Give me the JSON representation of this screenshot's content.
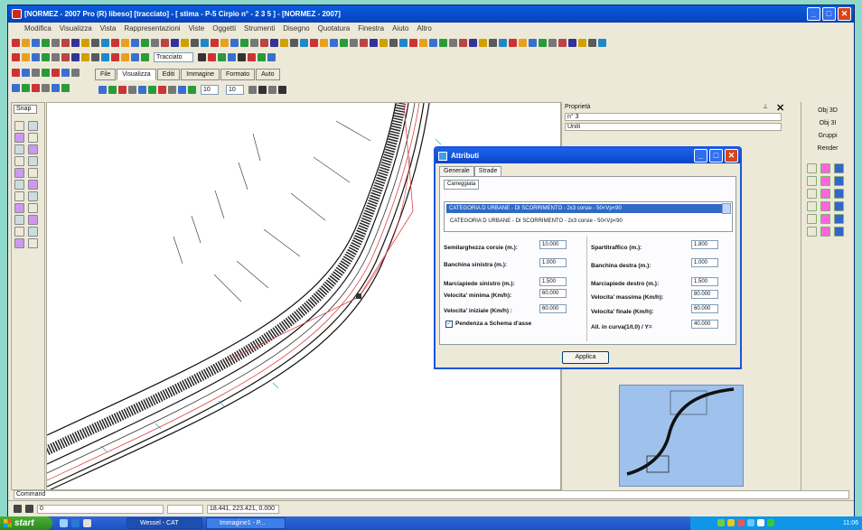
{
  "window": {
    "title": "[NORMEZ - 2007 Pro (R) libeso] [tracciato] - [ stima - P-5 Cirpio n° - 2 3 5 ] - [NORMEZ - 2007]"
  },
  "menu": [
    "Modifica",
    "Visualizza",
    "Vista",
    "Rappresentazioni",
    "Viste",
    "Oggetti",
    "Strumenti",
    "Disegno",
    "Quotatura",
    "Finestra",
    "Aiuto",
    "Altro"
  ],
  "toolbar": {
    "layer_combo": "Tracciato",
    "coord1": "10",
    "coord2": "10"
  },
  "mode_tabs": [
    "File",
    "Visualizza",
    "Editi",
    "Immagine",
    "Formato",
    "Auto"
  ],
  "left_toolbar": {
    "snap_label": "Snap"
  },
  "properties": {
    "header": "Proprietà",
    "row1": "n° 3",
    "row2": "Uniti"
  },
  "right_panel": [
    "Obj 3D",
    "Obj 3I",
    "Gruppi",
    "Render"
  ],
  "dialog": {
    "title": "Attributi",
    "tabs": [
      "Generale",
      "Strade"
    ],
    "subtab": "Carreggiata",
    "selected_item": "CATEGORIA D URBANE - DI SCORRIMENTO - 2x3 corsie - 50<Vp<90",
    "section_item": "CATEGORIA D URBANE - DI SCORRIMENTO - 2x3 corsie - 50<Vp<90",
    "fields_left": [
      {
        "label": "Semilarghezza corsie (m.):",
        "value": "10.000"
      },
      {
        "label": "Banchina sinistra (m.):",
        "value": "1.000"
      },
      {
        "label": "Marciapiede sinistro (m.):",
        "value": "1.500"
      },
      {
        "label": "Velocita' minima (Km/h):",
        "value": "60.000"
      },
      {
        "label": "Velocita' iniziale (Km/h) :",
        "value": "60.000"
      }
    ],
    "fields_right": [
      {
        "label": "Spartitraffico (m.):",
        "value": "1.800"
      },
      {
        "label": "Banchina destra (m.):",
        "value": "1.000"
      },
      {
        "label": "Marciapiede destro (m.):",
        "value": "1.500"
      },
      {
        "label": "Velocita' massima (Km/h):",
        "value": "80.000"
      },
      {
        "label": "Velocita' finale (Km/h):",
        "value": "60.000"
      },
      {
        "label": "All. in curva(1/t.0) / Y=",
        "value": "40.000"
      }
    ],
    "checkbox_label": "Pendenza a Schema d'asse",
    "apply": "Applica"
  },
  "command": {
    "label": "Command"
  },
  "status": {
    "layer": "0",
    "coords": "18.441, 223.421, 0.000"
  },
  "taskbar": {
    "start": "start",
    "tasks": [
      "Wessel - CAT",
      "Immagine1 - P..."
    ],
    "clock": "11:06"
  }
}
